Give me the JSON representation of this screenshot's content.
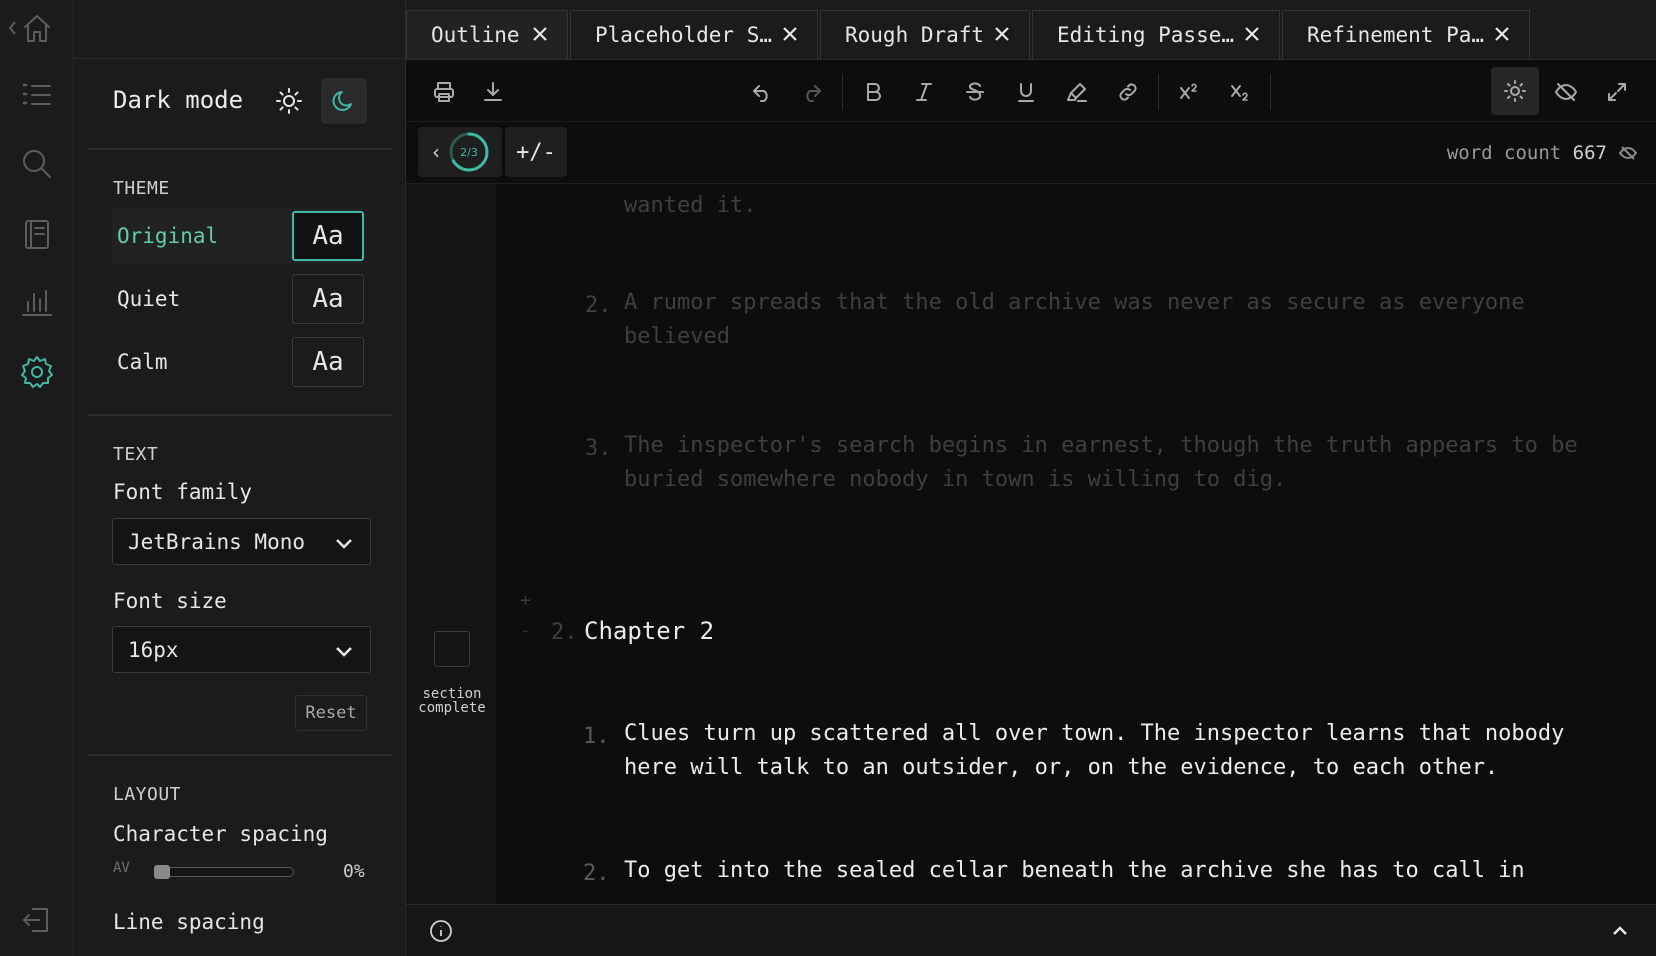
{
  "tabs": [
    {
      "label": "Outline",
      "active": true
    },
    {
      "label": "Placeholder S…"
    },
    {
      "label": "Rough Draft"
    },
    {
      "label": "Editing Passe…"
    },
    {
      "label": "Refinement Pa…"
    }
  ],
  "rail": {
    "items": [
      "home-icon",
      "list-icon",
      "search-icon",
      "notebook-icon",
      "stats-icon",
      "settings-icon"
    ],
    "active": "settings-icon",
    "bottom": "logout-icon"
  },
  "settings": {
    "dark_mode_label": "Dark mode",
    "theme_heading": "THEME",
    "themes": [
      {
        "name": "Original",
        "sample": "Aa",
        "selected": true
      },
      {
        "name": "Quiet",
        "sample": "Aa"
      },
      {
        "name": "Calm",
        "sample": "Aa"
      }
    ],
    "text_heading": "TEXT",
    "font_family_label": "Font family",
    "font_family_value": "JetBrains Mono",
    "font_size_label": "Font size",
    "font_size_value": "16px",
    "reset_label": "Reset",
    "layout_heading": "LAYOUT",
    "char_spacing_label": "Character spacing",
    "char_spacing_icon": "AV",
    "char_spacing_value": "0%",
    "char_spacing_level": 0,
    "line_spacing_label": "Line spacing"
  },
  "editor": {
    "progress": "2/3",
    "progress_fraction": 0.6667,
    "plus_minus": "+/-",
    "word_count_label": "word count",
    "word_count_value": "667",
    "section_complete": [
      "section",
      "complete"
    ],
    "chapter_number": "2.",
    "chapter_title": "Chapter 2",
    "plus": "+",
    "minus": "-",
    "faded_lines": [
      {
        "num": "",
        "text": "wanted it."
      },
      {
        "num": "2.",
        "text": "A rumor spreads that the old archive was never as secure as everyone"
      },
      {
        "num": "",
        "text": "believed"
      },
      {
        "num": "3.",
        "text": "The inspector's search begins in earnest, though the truth appears to be"
      },
      {
        "num": "",
        "text": "buried somewhere nobody in town is willing to dig."
      }
    ],
    "lines": [
      {
        "num": "1.",
        "text": "Clues turn up scattered all over town. The inspector learns that nobody"
      },
      {
        "num": "",
        "text": "here will talk to an outsider, or, on the evidence, to each other."
      },
      {
        "num": "2.",
        "text": "To get into the sealed cellar beneath the archive she has to call in"
      }
    ]
  },
  "colors": {
    "accent": "#3fb8a4",
    "background": "#0d0d0d",
    "panel": "#1b1b1b"
  }
}
